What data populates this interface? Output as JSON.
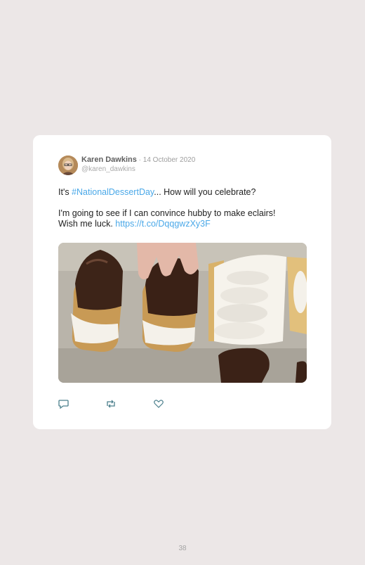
{
  "tweet": {
    "author_name": "Karen Dawkins",
    "date": " · 14 October 2020",
    "handle": "@karen_dawkins",
    "line1_prefix": "It's ",
    "hashtag": "#NationalDessertDay",
    "line1_suffix": "... How will you celebrate?",
    "line2": "I'm going to see if I can convince hubby to make eclairs!",
    "line3_prefix": "Wish me luck. ",
    "url": "https://t.co/DqqgwzXy3F",
    "media_description_icon": "photo-icon"
  },
  "actions": {
    "reply_icon": "reply-icon",
    "retweet_icon": "retweet-icon",
    "like_icon": "heart-icon"
  },
  "page": {
    "number": "38"
  },
  "colors": {
    "background": "#ece7e7",
    "card": "#ffffff",
    "link": "#4aa8e8"
  }
}
